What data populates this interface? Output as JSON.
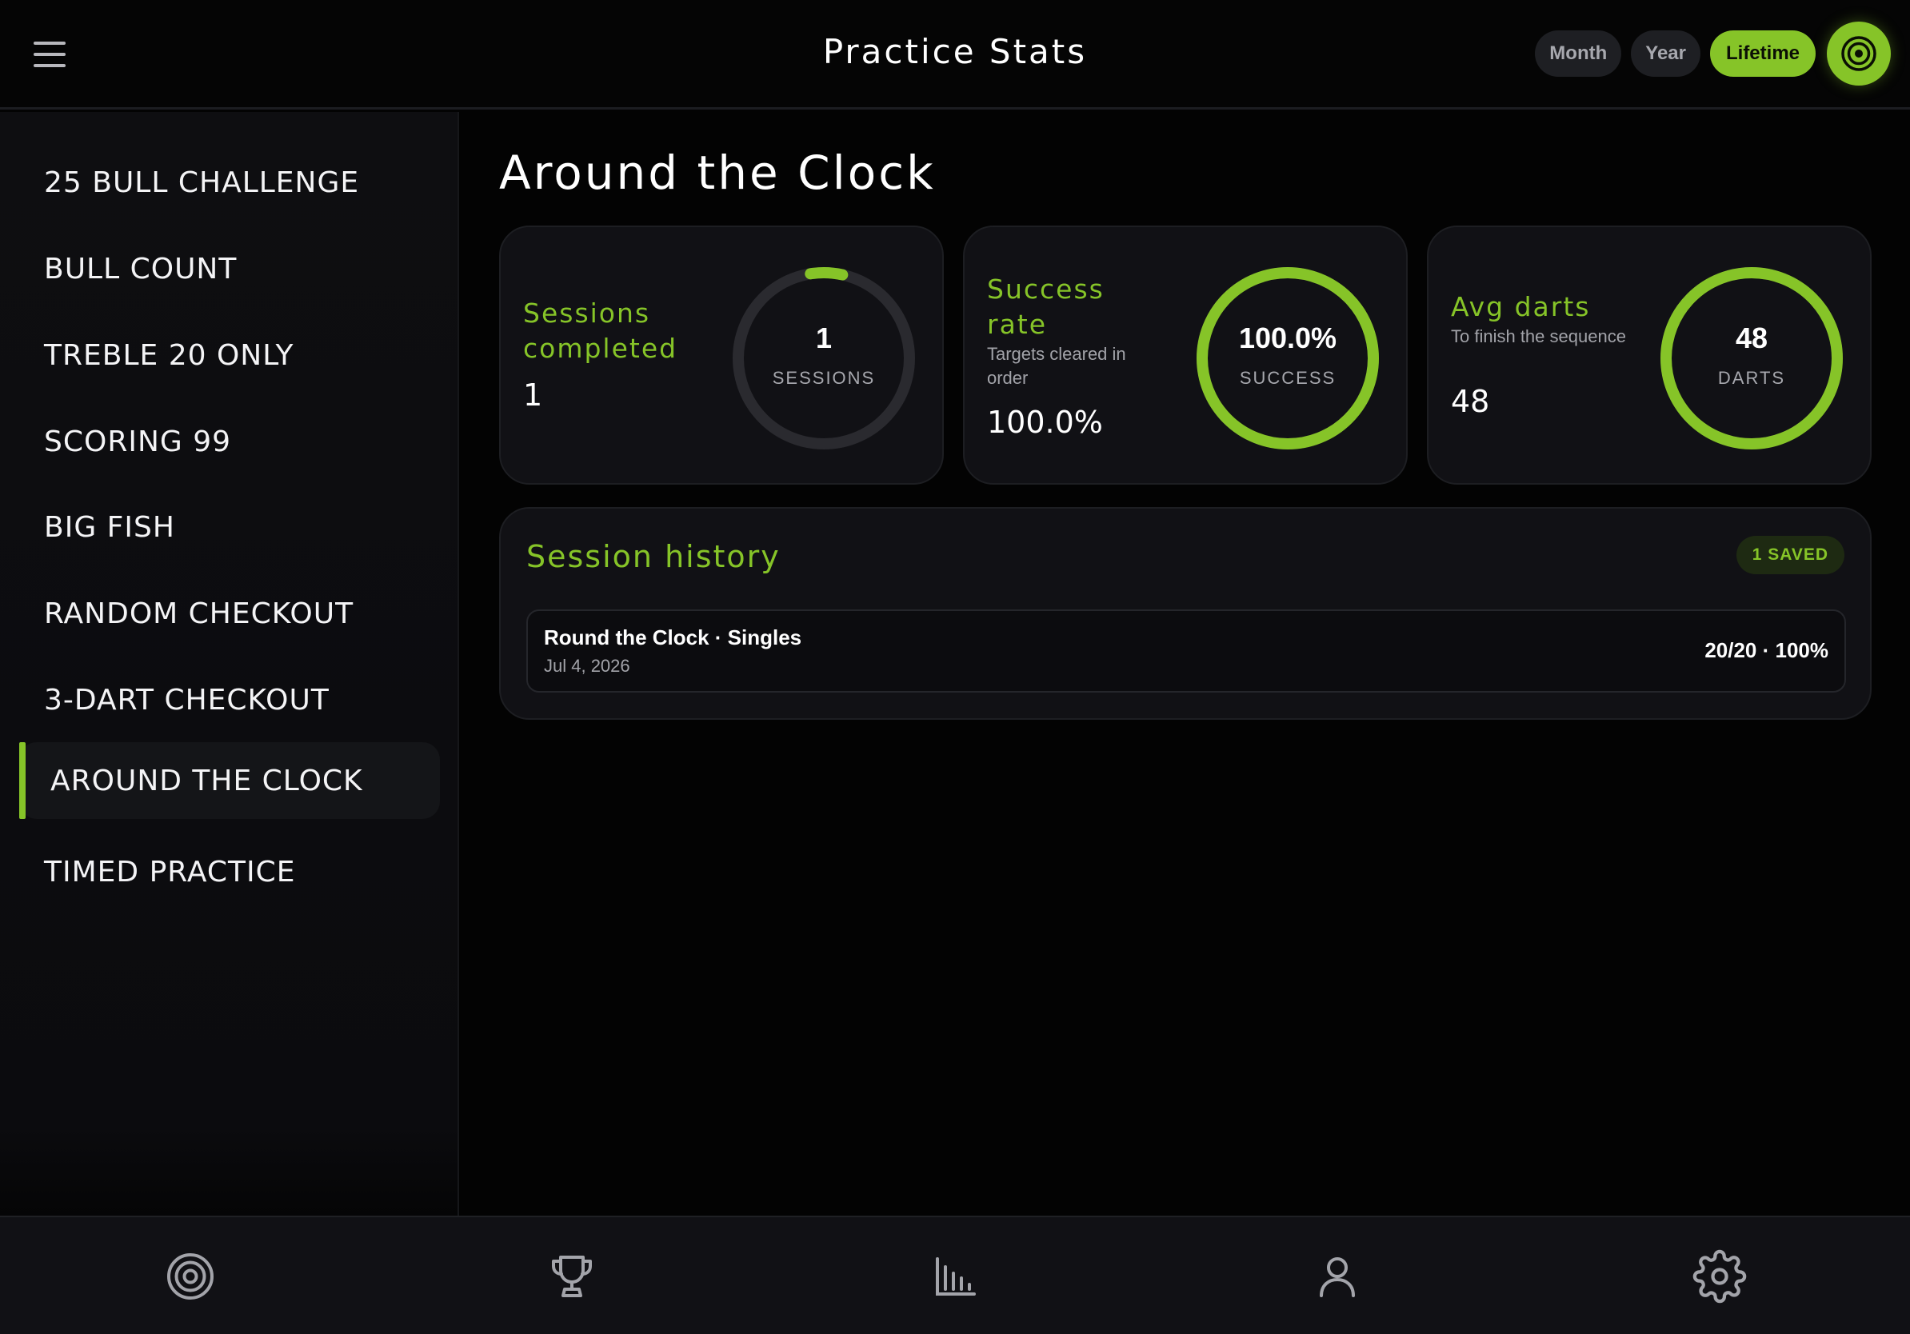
{
  "header": {
    "title": "Practice Stats",
    "ranges": [
      "Month",
      "Year",
      "Lifetime"
    ],
    "active_range": "Lifetime",
    "badge_icon": "dartboard-icon"
  },
  "sidebar": {
    "items": [
      {
        "label": "25 BULL CHALLENGE"
      },
      {
        "label": "BULL COUNT"
      },
      {
        "label": "TREBLE 20 ONLY"
      },
      {
        "label": "SCORING 99"
      },
      {
        "label": "BIG FISH"
      },
      {
        "label": "RANDOM CHECKOUT"
      },
      {
        "label": "3-DART CHECKOUT"
      },
      {
        "label": "AROUND THE CLOCK"
      },
      {
        "label": "TIMED PRACTICE"
      }
    ],
    "active_index": 7
  },
  "main": {
    "title": "Around the Clock",
    "stats": [
      {
        "label_line1": "Sessions",
        "label_line2": "completed",
        "subtitle": "",
        "value": "1",
        "ring_value": "1",
        "ring_unit": "SESSIONS",
        "progress": 0.06
      },
      {
        "label_line1": "Success",
        "label_line2": "rate",
        "subtitle": "Targets cleared in order",
        "value": "100.0%",
        "ring_value": "100.0%",
        "ring_unit": "SUCCESS",
        "progress": 1.0
      },
      {
        "label_line1": "Avg darts",
        "label_line2": "",
        "subtitle": "To finish the sequence",
        "value": "48",
        "ring_value": "48",
        "ring_unit": "DARTS",
        "progress": 1.0
      }
    ],
    "history": {
      "title": "Session history",
      "badge": "1 SAVED",
      "rows": [
        {
          "name": "Round the Clock · Singles",
          "date": "Jul 4, 2026",
          "result": "20/20 · 100%"
        }
      ]
    }
  },
  "bottom_nav": {
    "tabs": [
      "dartboard-icon",
      "trophy-icon",
      "bar-chart-icon",
      "profile-icon",
      "gear-icon"
    ]
  },
  "colors": {
    "accent": "#86c428",
    "background": "#030303",
    "card": "#111115",
    "ring_track": "#2a2a2f"
  }
}
